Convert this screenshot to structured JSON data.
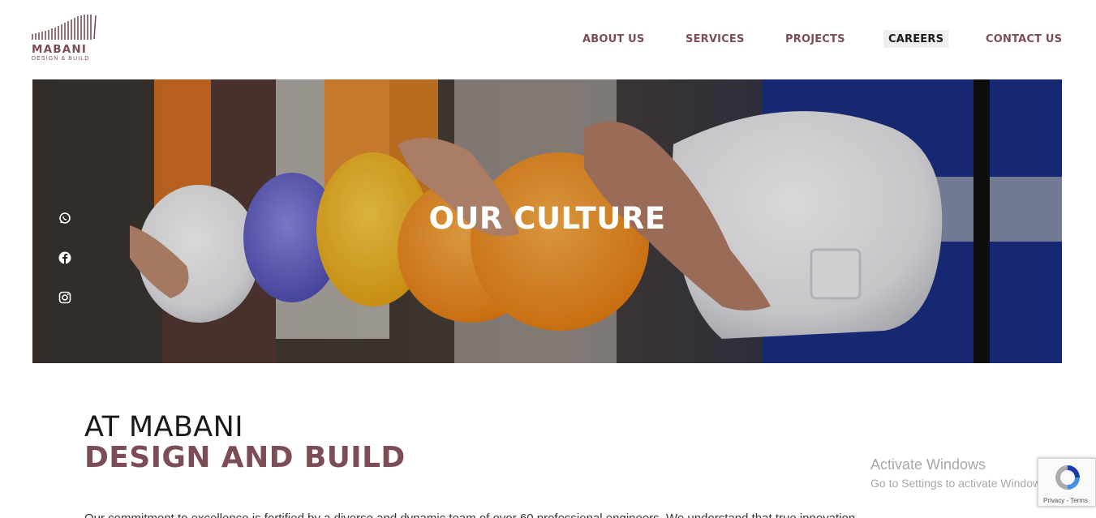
{
  "header": {
    "logo_name": "MABANI",
    "logo_tagline": "DESIGN & BUILD",
    "nav": {
      "about": "ABOUT US",
      "services": "SERVICES",
      "projects": "PROJECTS",
      "careers": "CAREERS",
      "contact": "CONTACT US"
    },
    "active_nav": "CAREERS"
  },
  "hero": {
    "title": "OUR CULTURE",
    "social_icons": [
      "whatsapp-icon",
      "facebook-icon",
      "instagram-icon"
    ]
  },
  "intro": {
    "line1": "AT MABANI",
    "line2": "DESIGN AND BUILD",
    "body": "Our commitment to excellence is fortified by a diverse and dynamic team of over 60 professional engineers. We understand that true innovation"
  },
  "overlay": {
    "activate_title": "Activate Windows",
    "activate_sub": "Go to Settings to activate Windows.",
    "recaptcha_links": "Privacy - Terms"
  },
  "colors": {
    "brand": "#7c4d55",
    "hero_text": "#ffffff",
    "nav_active_bg": "#efefef"
  }
}
